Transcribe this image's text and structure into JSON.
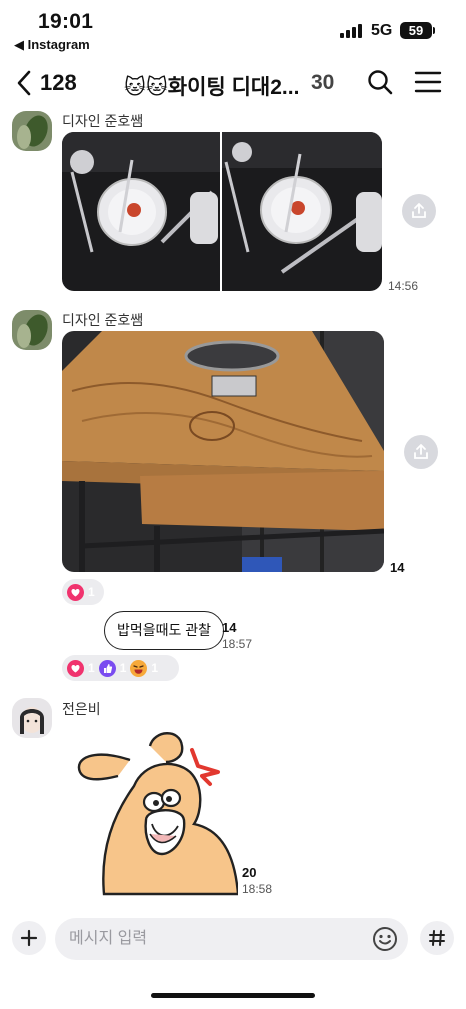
{
  "status_bar": {
    "time": "19:01",
    "back_app": "◀ Instagram",
    "network": "5G",
    "battery": "59"
  },
  "header": {
    "back_count": "128",
    "title": "🐱🐱화이팅 디대2...",
    "member_count": "30",
    "icons": [
      "chevron-left-icon",
      "search-icon",
      "menu-icon"
    ]
  },
  "messages": [
    {
      "sender": "디자인 준호쌤",
      "type": "photos",
      "photo_count": 2,
      "time": "14:56"
    },
    {
      "sender": "디자인 준호쌤",
      "type": "photo",
      "unread": "14",
      "reactions": [
        {
          "icon": "heart-icon",
          "count": "1"
        }
      ]
    },
    {
      "type": "text",
      "text": "밥먹을때도 관찰",
      "unread": "14",
      "time": "18:57",
      "reactions": [
        {
          "icon": "heart-icon",
          "count": "1"
        },
        {
          "icon": "thumbs-up-icon",
          "count": "1"
        },
        {
          "icon": "laugh-emoji-icon",
          "count": "1"
        }
      ]
    },
    {
      "sender": "전은비",
      "type": "sticker",
      "unread": "20",
      "time": "18:58"
    }
  ],
  "composer": {
    "placeholder": "메시지 입력",
    "value": ""
  },
  "colors": {
    "heart": "#f0336e",
    "thumbs": "#7a4cf0",
    "laugh": "#f7a93a",
    "share_button": "#d8d9de",
    "sticker_fill": "#f7c58a"
  }
}
